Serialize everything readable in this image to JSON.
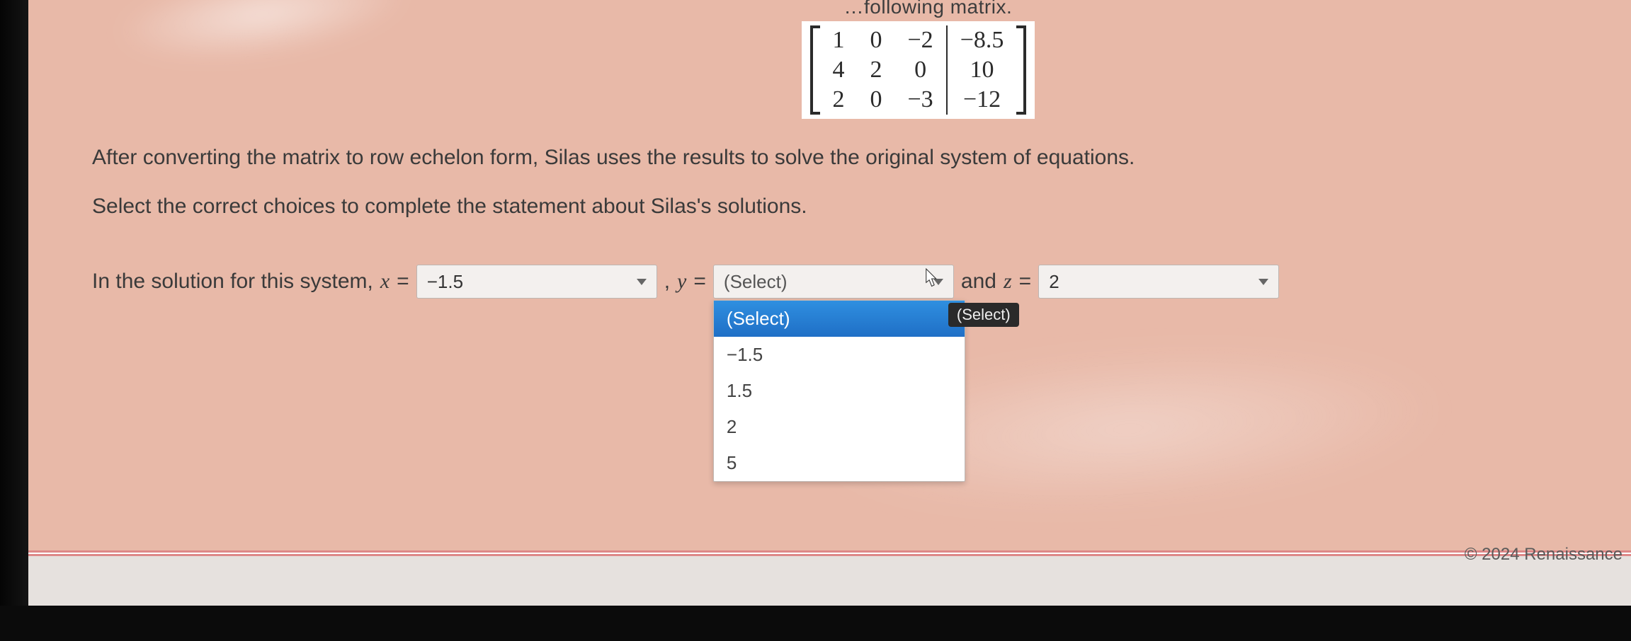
{
  "header_fragment": "…following matrix.",
  "matrix": {
    "rows": [
      {
        "a": "1",
        "b": "0",
        "c": "−2",
        "d": "−8.5"
      },
      {
        "a": "4",
        "b": "2",
        "c": "0",
        "d": "10"
      },
      {
        "a": "2",
        "b": "0",
        "c": "−3",
        "d": "−12"
      }
    ]
  },
  "paragraph1": "After converting the matrix to row echelon form, Silas uses the results to solve the original system of equations.",
  "paragraph2": "Select the correct choices to complete the statement about Silas's solutions.",
  "sentence": {
    "lead": "In the solution for this system, ",
    "x_label": "x",
    "eq": " = ",
    "comma_y": " ,  ",
    "y_label": "y",
    "and": "   and ",
    "z_label": "z"
  },
  "selects": {
    "x": {
      "value": "−1.5"
    },
    "y": {
      "placeholder": "(Select)",
      "tooltip": "(Select)",
      "options": [
        "(Select)",
        "−1.5",
        "1.5",
        "2",
        "5"
      ]
    },
    "z": {
      "value": "2"
    }
  },
  "footer": {
    "copyright": "© 2024 Renaissance"
  }
}
